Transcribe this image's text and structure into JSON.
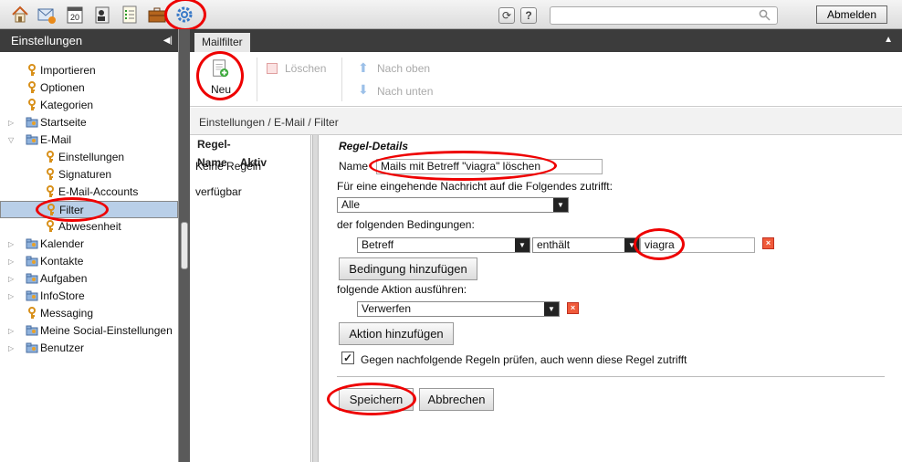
{
  "topbar": {
    "icons": [
      "home-icon",
      "mail-icon",
      "calendar-icon",
      "contacts-icon",
      "tasks-icon",
      "infostore-icon",
      "settings-icon"
    ],
    "calendar_day": "20",
    "refresh_symbol": "⟳",
    "help_symbol": "?",
    "search": {
      "value": "",
      "placeholder": ""
    },
    "logout_label": "Abmelden"
  },
  "sidebar": {
    "title": "Einstellungen",
    "items": [
      {
        "label": "Importieren",
        "icon": "key-icon"
      },
      {
        "label": "Optionen",
        "icon": "key-icon"
      },
      {
        "label": "Kategorien",
        "icon": "key-icon"
      },
      {
        "label": "Startseite",
        "icon": "folder-key-icon"
      },
      {
        "label": "E-Mail",
        "icon": "folder-key-icon"
      },
      {
        "label": "Einstellungen",
        "icon": "key-icon"
      },
      {
        "label": "Signaturen",
        "icon": "key-icon"
      },
      {
        "label": "E-Mail-Accounts",
        "icon": "key-icon"
      },
      {
        "label": "Filter",
        "icon": "key-icon"
      },
      {
        "label": "Abwesenheit",
        "icon": "key-icon"
      },
      {
        "label": "Kalender",
        "icon": "folder-key-icon"
      },
      {
        "label": "Kontakte",
        "icon": "folder-key-icon"
      },
      {
        "label": "Aufgaben",
        "icon": "folder-key-icon"
      },
      {
        "label": "InfoStore",
        "icon": "folder-key-icon"
      },
      {
        "label": "Messaging",
        "icon": "key-icon"
      },
      {
        "label": "Meine Social-Einstellungen",
        "icon": "folder-key-icon"
      },
      {
        "label": "Benutzer",
        "icon": "folder-key-icon"
      }
    ]
  },
  "tab": {
    "label": "Mailfilter"
  },
  "toolbar": {
    "new_label": "Neu",
    "delete_label": "Löschen",
    "up_label": "Nach oben",
    "down_label": "Nach unten"
  },
  "breadcrumb": "Einstellungen / E-Mail / Filter",
  "rules": {
    "col_name": "Regel-Name",
    "col_active": "Aktiv",
    "empty": "Keine Regeln verfügbar"
  },
  "details": {
    "heading": "Regel-Details",
    "name_label": "Name",
    "name_value": "Mails mit Betreff \"viagra\" löschen",
    "applies_label": "Für eine eingehende Nachricht auf die Folgendes zutrifft:",
    "applies_value": "Alle",
    "conditions_label": "der folgenden Bedingungen:",
    "condition": {
      "field": "Betreff",
      "operator": "enthält",
      "value": "viagra"
    },
    "add_condition": "Bedingung hinzufügen",
    "action_label": "folgende Aktion ausführen:",
    "action_value": "Verwerfen",
    "add_action": "Aktion hinzufügen",
    "continue_checked": true,
    "continue_label": "Gegen nachfolgende Regeln prüfen, auch wenn diese Regel zutrifft",
    "save": "Speichern",
    "cancel": "Abbrechen"
  },
  "colors": {
    "highlight_ring": "#e00000",
    "selected_row": "#b9cfe8",
    "header_dark": "#3c3c3c"
  }
}
